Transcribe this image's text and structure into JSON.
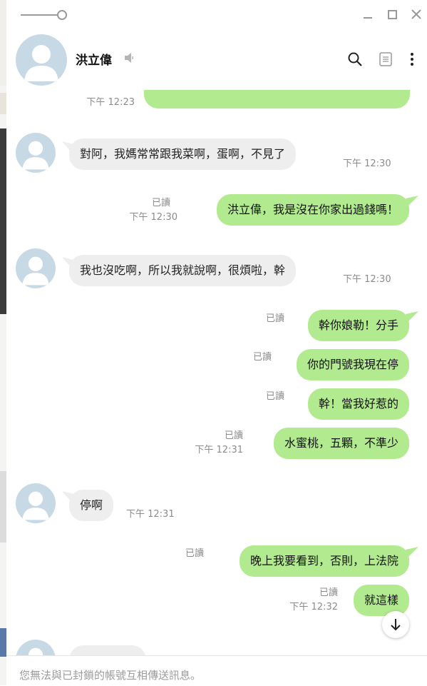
{
  "window": {
    "controls": [
      "minimize-icon",
      "maximize-icon",
      "close-icon"
    ]
  },
  "header": {
    "contact_name": "洪立偉",
    "icons": [
      "mute-icon",
      "search-icon",
      "notes-icon",
      "more-icon"
    ]
  },
  "messages": [
    {
      "dir": "out",
      "text": "...",
      "time": "下午 12:23",
      "read": ""
    },
    {
      "dir": "in",
      "text": "對阿，我媽常常跟我菜啊，蛋啊，不見了",
      "time": "下午 12:30"
    },
    {
      "dir": "out",
      "text": "洪立偉，我是沒在你家出過錢嗎！",
      "time": "下午 12:30",
      "read": "已讀"
    },
    {
      "dir": "in",
      "text": "我也沒吃啊，所以我就說啊，很煩啦，幹",
      "time": "下午 12:30"
    },
    {
      "dir": "out",
      "text": "幹你娘勒！分手",
      "time": "",
      "read": "已讀"
    },
    {
      "dir": "out",
      "text": "你的門號我現在停",
      "time": "",
      "read": "已讀"
    },
    {
      "dir": "out",
      "text": "幹！當我好惹的",
      "time": "",
      "read": "已讀"
    },
    {
      "dir": "out",
      "text": "水蜜桃，五顆，不準少",
      "time": "下午 12:31",
      "read": "已讀"
    },
    {
      "dir": "in",
      "text": "停啊",
      "time": "下午 12:31"
    },
    {
      "dir": "out",
      "text": "晚上我要看到，否則，上法院",
      "time": "",
      "read": "已讀"
    },
    {
      "dir": "out",
      "text": "就這樣",
      "time": "下午 12:32",
      "read": "已讀"
    }
  ],
  "footer": {
    "notice": "您無法與已封鎖的帳號互相傳送訊息。"
  },
  "colors": {
    "outgoing_bubble": "#b2ea8f",
    "incoming_bubble": "#eeeeef",
    "avatar_bg": "#c8d9e6",
    "meta_text": "#8b8b8b"
  }
}
